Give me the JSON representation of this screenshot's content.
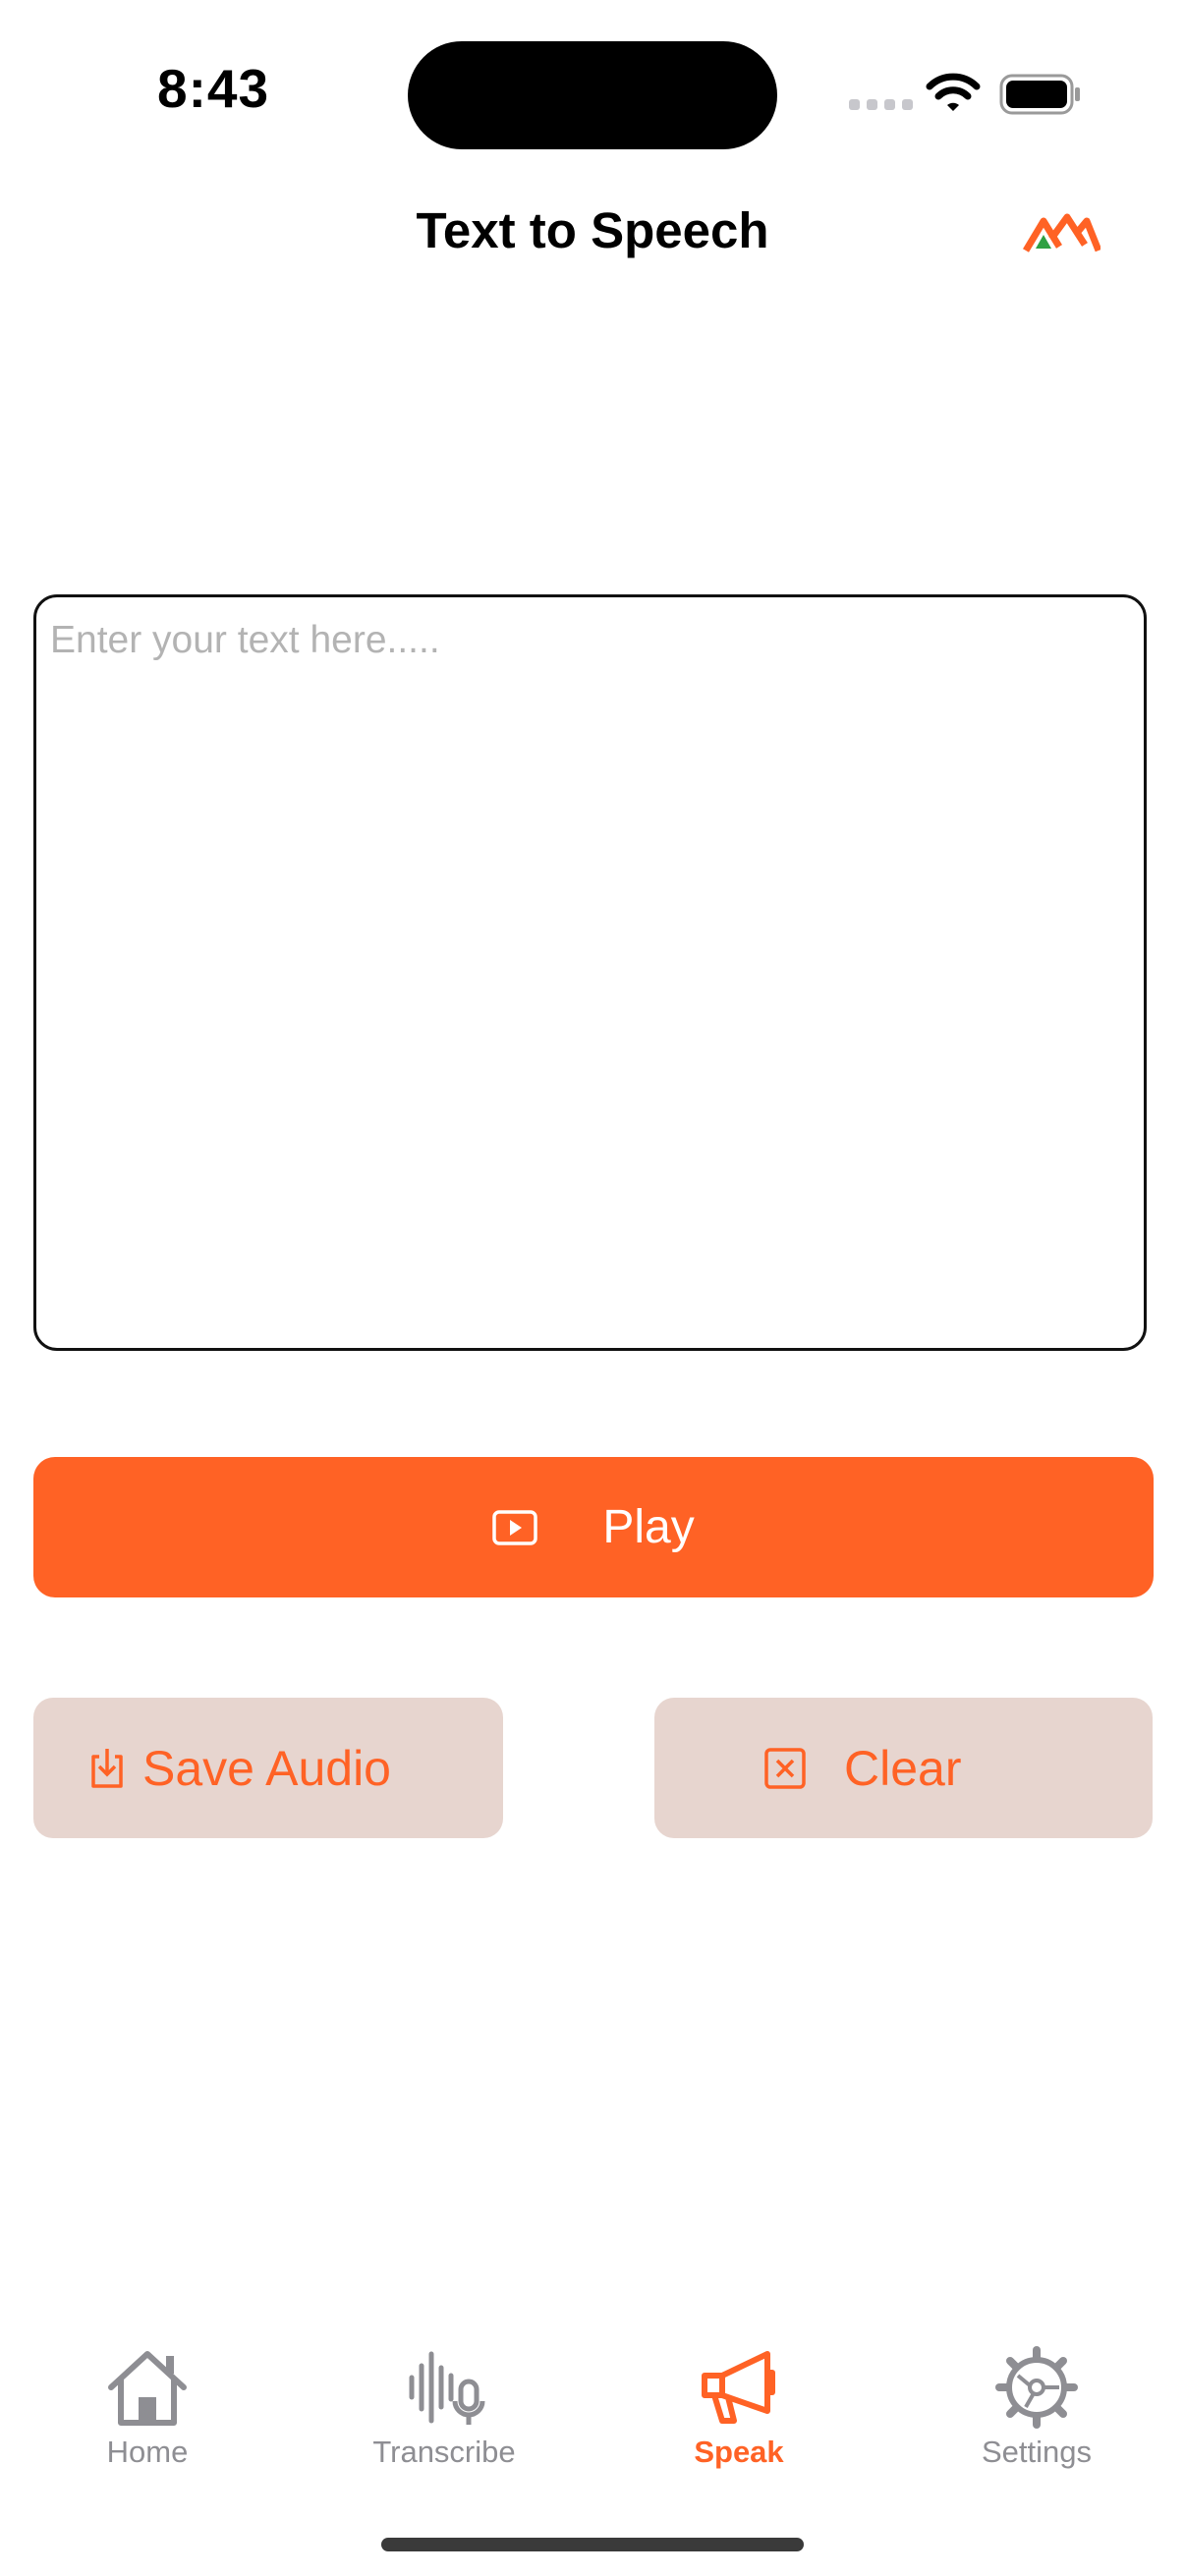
{
  "status_bar": {
    "time": "8:43"
  },
  "header": {
    "title": "Text to Speech"
  },
  "editor": {
    "placeholder": "Enter your text here.....",
    "value": ""
  },
  "actions": {
    "play_label": "Play",
    "save_label": "Save Audio",
    "clear_label": "Clear"
  },
  "tab_bar": {
    "items": [
      {
        "label": "Home",
        "icon": "house-icon",
        "active": false
      },
      {
        "label": "Transcribe",
        "icon": "waveform-mic-icon",
        "active": false
      },
      {
        "label": "Speak",
        "icon": "megaphone-icon",
        "active": true
      },
      {
        "label": "Settings",
        "icon": "gear-icon",
        "active": false
      }
    ]
  },
  "colors": {
    "accent": "#ff6225",
    "secondary_button_bg": "#e7d5cf",
    "inactive_tab": "#8e8e93"
  }
}
